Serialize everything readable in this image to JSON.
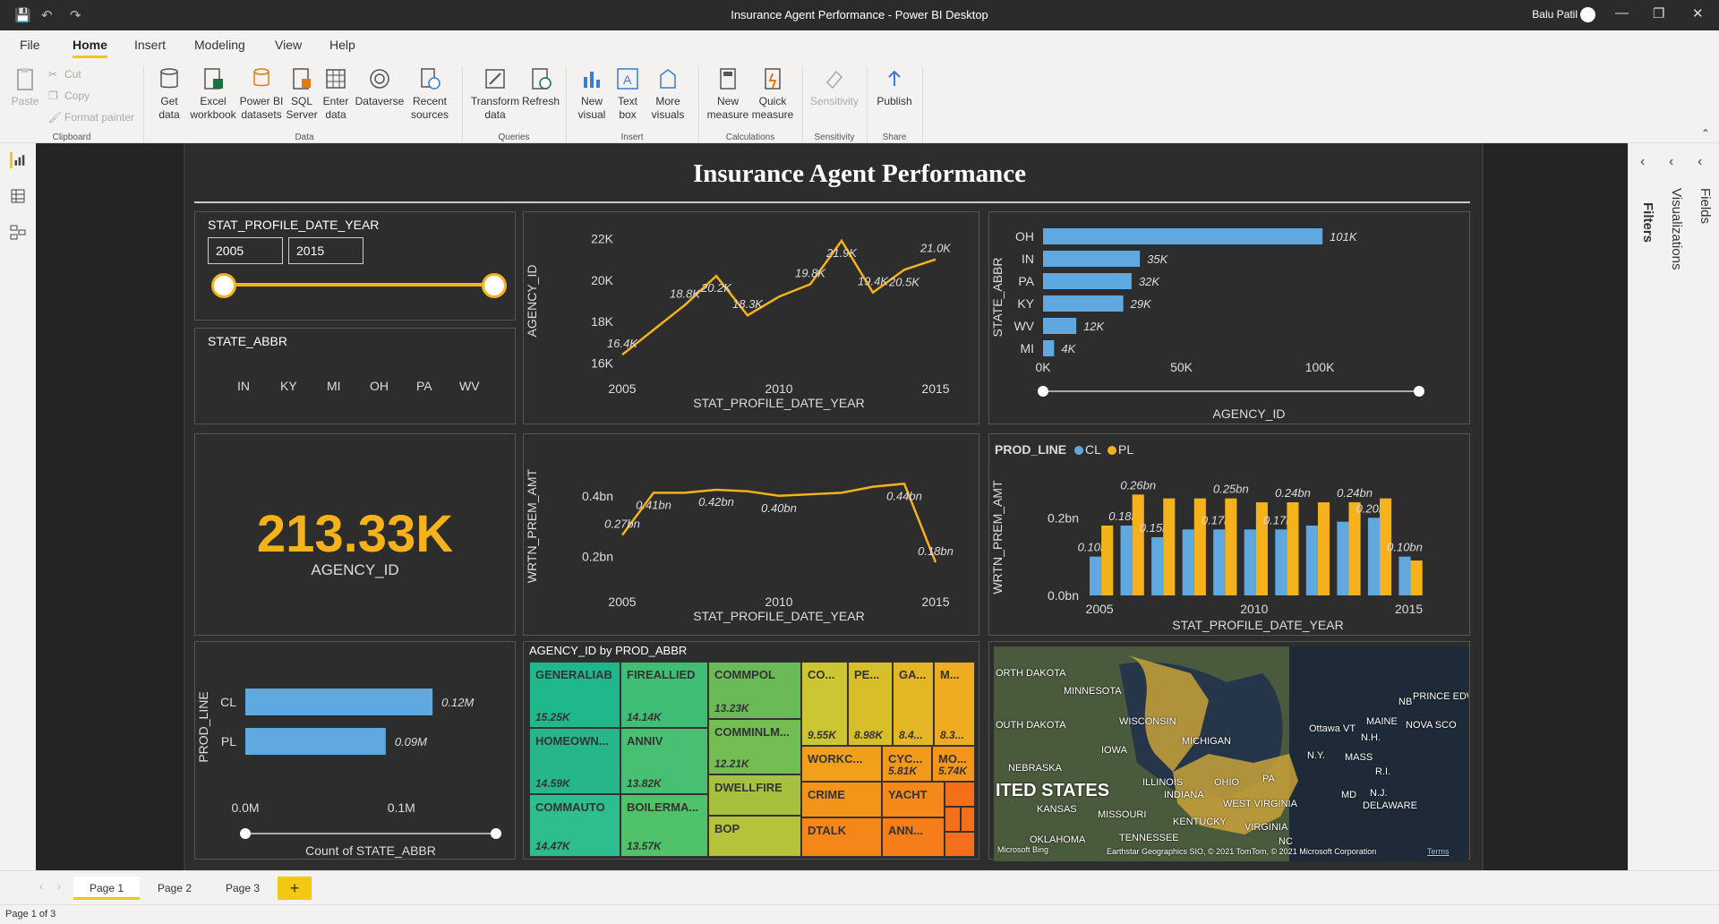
{
  "window": {
    "title": "Insurance Agent Performance - Power BI Desktop",
    "user": "Balu Patil"
  },
  "menu": [
    "File",
    "Home",
    "Insert",
    "Modeling",
    "View",
    "Help"
  ],
  "ribbon": {
    "clipboard": {
      "paste": "Paste",
      "cut": "Cut",
      "copy": "Copy",
      "format_painter": "Format painter",
      "group": "Clipboard"
    },
    "data": {
      "get_data": "Get data",
      "excel": "Excel workbook",
      "powerbi": "Power BI datasets",
      "sql": "SQL Server",
      "enter": "Enter data",
      "dataverse": "Dataverse",
      "recent": "Recent sources",
      "group": "Data"
    },
    "queries": {
      "transform": "Transform data",
      "refresh": "Refresh",
      "group": "Queries"
    },
    "insert": {
      "new_visual": "New visual",
      "text_box": "Text box",
      "more_visuals": "More visuals",
      "group": "Insert"
    },
    "calculations": {
      "new_measure": "New measure",
      "quick_measure": "Quick measure",
      "group": "Calculations"
    },
    "sensitivity": {
      "label": "Sensitivity",
      "group": "Sensitivity"
    },
    "share": {
      "publish": "Publish",
      "group": "Share"
    }
  },
  "panes": {
    "filters": "Filters",
    "visualizations": "Visualizations",
    "fields": "Fields"
  },
  "dashboard": {
    "title": "Insurance Agent Performance",
    "year_slicer": {
      "title": "STAT_PROFILE_DATE_YEAR",
      "from": "2005",
      "to": "2015"
    },
    "state_slicer": {
      "title": "STATE_ABBR",
      "items": [
        "IN",
        "KY",
        "MI",
        "OH",
        "PA",
        "WV"
      ]
    },
    "kpi": {
      "value": "213.33K",
      "label": "AGENCY_ID"
    },
    "treemap": {
      "title": "AGENCY_ID by PROD_ABBR"
    },
    "map": {
      "attribution": "Earthstar Geographics SIO, © 2021 TomTom, © 2021 Microsoft Corporation",
      "terms": "Terms",
      "brand": "Microsoft Bing"
    }
  },
  "pages": {
    "tabs": [
      "Page 1",
      "Page 2",
      "Page 3"
    ],
    "status": "Page 1 of 3"
  },
  "colors": {
    "accent": "#f2c811",
    "blue": "#5fa8e0",
    "orange": "#f5b21b",
    "green": "#2dbd8f"
  },
  "chart_data": [
    {
      "id": "agency_trend",
      "type": "line",
      "x": [
        2005,
        2006,
        2007,
        2008,
        2009,
        2010,
        2011,
        2012,
        2013,
        2014,
        2015
      ],
      "values": [
        16.4,
        17.6,
        18.8,
        20.2,
        18.3,
        19.2,
        19.8,
        21.9,
        19.4,
        20.5,
        21.0
      ],
      "labels": [
        "16.4K",
        "",
        "18.8K",
        "20.2K",
        "18.3K",
        "",
        "19.8K",
        "21.9K",
        "19.4K",
        "20.5K",
        "21.0K"
      ],
      "ylim": [
        15.5,
        22.5
      ],
      "yticks": [
        "16K",
        "18K",
        "20K",
        "22K"
      ],
      "xticks": [
        "2005",
        "2010",
        "2015"
      ],
      "xlabel": "STAT_PROFILE_DATE_YEAR",
      "ylabel": "AGENCY_ID"
    },
    {
      "id": "state_bar",
      "type": "bar",
      "orientation": "horizontal",
      "categories": [
        "OH",
        "IN",
        "PA",
        "KY",
        "WV",
        "MI"
      ],
      "values": [
        101,
        35,
        32,
        29,
        12,
        4
      ],
      "labels": [
        "101K",
        "35K",
        "32K",
        "29K",
        "12K",
        "4K"
      ],
      "xticks": [
        "0K",
        "50K",
        "100K"
      ],
      "xlim": [
        0,
        110
      ],
      "xlabel": "AGENCY_ID",
      "ylabel": "STATE_ABBR"
    },
    {
      "id": "prem_trend",
      "type": "line",
      "x": [
        2005,
        2006,
        2007,
        2008,
        2009,
        2010,
        2011,
        2012,
        2013,
        2014,
        2015
      ],
      "values": [
        0.27,
        0.41,
        0.41,
        0.42,
        0.415,
        0.4,
        0.405,
        0.41,
        0.43,
        0.44,
        0.18
      ],
      "labels": [
        "0.27bn",
        "0.41bn",
        "",
        "0.42bn",
        "",
        "0.40bn",
        "",
        "",
        "",
        "0.44bn",
        "0.18bn"
      ],
      "ylim": [
        0.1,
        0.5
      ],
      "yticks": [
        "0.2bn",
        "0.4bn"
      ],
      "xticks": [
        "2005",
        "2010",
        "2015"
      ],
      "xlabel": "STAT_PROFILE_DATE_YEAR",
      "ylabel": "WRTN_PREM_AMT"
    },
    {
      "id": "prod_line_bars",
      "type": "bar",
      "x": [
        2005,
        2006,
        2007,
        2008,
        2009,
        2010,
        2011,
        2012,
        2013,
        2014,
        2015
      ],
      "legend_title": "PROD_LINE",
      "series": [
        {
          "name": "CL",
          "values": [
            0.1,
            0.18,
            0.15,
            0.17,
            0.17,
            0.17,
            0.17,
            0.18,
            0.19,
            0.2,
            0.1
          ]
        },
        {
          "name": "PL",
          "values": [
            0.18,
            0.26,
            0.25,
            0.25,
            0.25,
            0.24,
            0.24,
            0.24,
            0.24,
            0.25,
            0.09
          ]
        }
      ],
      "labels": [
        [
          "0.10bn",
          "0.18bn",
          "0.15bn",
          "",
          "0.17bn",
          "",
          "0.17bn",
          "",
          "",
          "0.20bn",
          "0.10bn"
        ],
        [
          "",
          "0.26bn",
          "",
          "",
          "0.25bn",
          "",
          "0.24bn",
          "",
          "0.24bn",
          "",
          ""
        ]
      ],
      "ylim": [
        0,
        0.3
      ],
      "yticks": [
        "0.0bn",
        "0.2bn"
      ],
      "xticks": [
        "2005",
        "2010",
        "2015"
      ],
      "xlabel": "STAT_PROFILE_DATE_YEAR",
      "ylabel": "WRTN_PREM_AMT"
    },
    {
      "id": "prod_line_count",
      "type": "bar",
      "orientation": "horizontal",
      "categories": [
        "CL",
        "PL"
      ],
      "values": [
        0.12,
        0.09
      ],
      "labels": [
        "0.12M",
        "0.09M"
      ],
      "xticks": [
        "0.0M",
        "0.1M"
      ],
      "xlim": [
        0,
        0.14
      ],
      "xlabel": "Count of STATE_ABBR",
      "ylabel": "PROD_LINE"
    },
    {
      "id": "treemap",
      "type": "treemap",
      "items": [
        {
          "name": "GENERALIAB",
          "value": "15.25K"
        },
        {
          "name": "HOMEOWN...",
          "value": "14.59K"
        },
        {
          "name": "COMMAUTO",
          "value": "14.47K"
        },
        {
          "name": "FIREALLIED",
          "value": "14.14K"
        },
        {
          "name": "ANNIV",
          "value": "13.82K"
        },
        {
          "name": "BOILERMA...",
          "value": "13.57K"
        },
        {
          "name": "COMMPOL",
          "value": "13.23K"
        },
        {
          "name": "COMMINLM...",
          "value": "12.21K"
        },
        {
          "name": "DWELLFIRE",
          "value": ""
        },
        {
          "name": "BOP",
          "value": ""
        },
        {
          "name": "CO...",
          "value": "9.55K"
        },
        {
          "name": "PE...",
          "value": "8.98K"
        },
        {
          "name": "GA...",
          "value": "8.4..."
        },
        {
          "name": "M...",
          "value": "8.3..."
        },
        {
          "name": "WORKC...",
          "value": ""
        },
        {
          "name": "CYC...",
          "value": "5.81K"
        },
        {
          "name": "MO...",
          "value": "5.74K"
        },
        {
          "name": "CRIME",
          "value": ""
        },
        {
          "name": "YACHT",
          "value": ""
        },
        {
          "name": "DTALK",
          "value": ""
        },
        {
          "name": "ANN...",
          "value": ""
        }
      ]
    }
  ],
  "map_labels": [
    "ORTH DAKOTA",
    "MINNESOTA",
    "WISCONSIN",
    "MICHIGAN",
    "OUTH DAKOTA",
    "IOWA",
    "NEBRASKA",
    "ILLINOIS",
    "INDIANA",
    "OHIO",
    "PA",
    "ITED STATES",
    "KANSAS",
    "MISSOURI",
    "KENTUCKY",
    "WEST VIRGINIA",
    "VIRGINIA",
    "OKLAHOMA",
    "TENNESSEE",
    "Ottawa",
    "MAINE",
    "N.Y.",
    "MASS",
    "N.H.",
    "VT",
    "R.I.",
    "N.J.",
    "DELAWARE",
    "MD",
    "NOVA SCO",
    "PRINCE EDWARD ISLAND",
    "NB",
    "NC"
  ]
}
